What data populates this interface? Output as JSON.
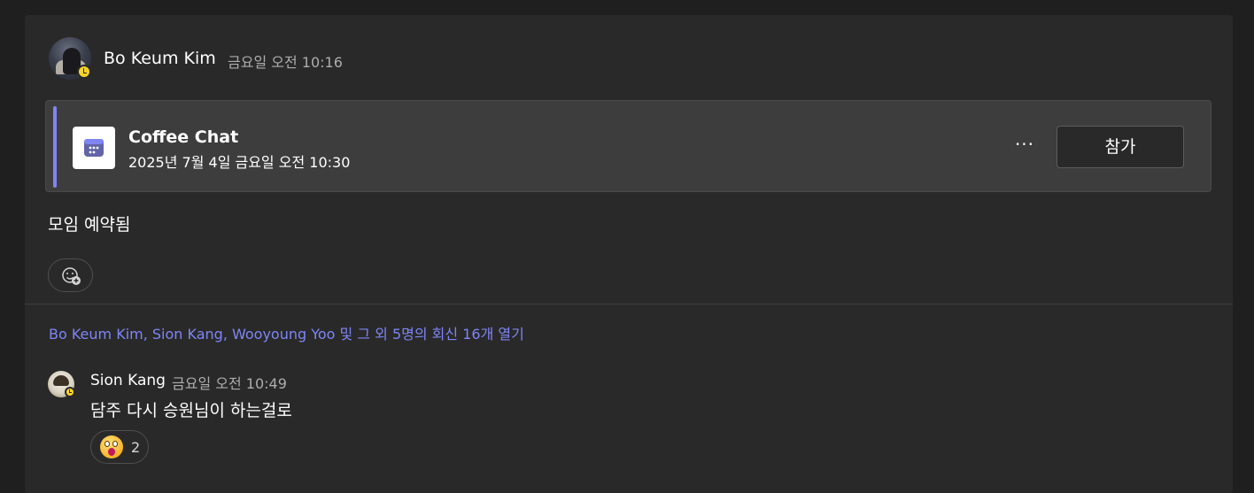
{
  "post": {
    "author": "Bo Keum Kim",
    "time": "금요일 오전 10:16",
    "message": "모임 예약됨"
  },
  "meeting_card": {
    "title": "Coffee Chat",
    "when": "2025년 7월 4일 금요일 오전 10:30",
    "more_label": "···",
    "join_label": "참가",
    "accent_color": "#7f85f5",
    "icon": "calendar-icon"
  },
  "replies_link": "Bo Keum Kim, Sion Kang, Wooyoung Yoo 및 그 외 5명의 회신 16개 열기",
  "reply": {
    "author": "Sion Kang",
    "time": "금요일 오전 10:49",
    "text": "담주 다시 승원님이 하는걸로",
    "reaction": {
      "emoji": "surprised-face-emoji",
      "count": "2"
    }
  },
  "icons": {
    "add_reaction": "add-reaction-icon",
    "status": "away-clock-icon"
  }
}
